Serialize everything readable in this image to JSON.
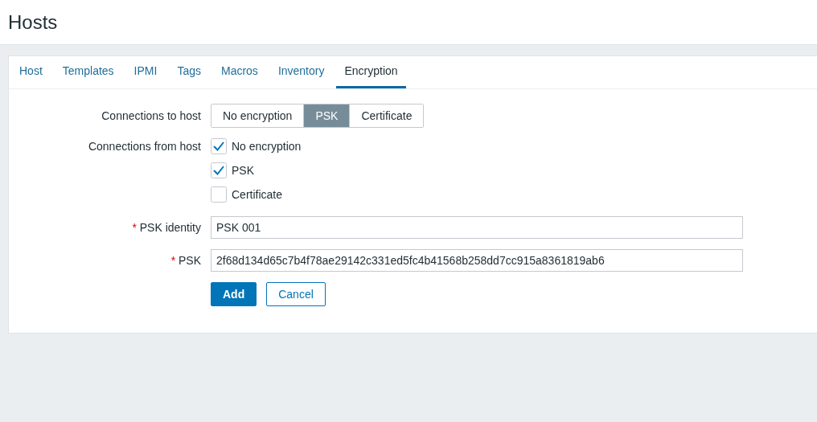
{
  "page_title": "Hosts",
  "tabs": [
    {
      "label": "Host",
      "selected": false
    },
    {
      "label": "Templates",
      "selected": false
    },
    {
      "label": "IPMI",
      "selected": false
    },
    {
      "label": "Tags",
      "selected": false
    },
    {
      "label": "Macros",
      "selected": false
    },
    {
      "label": "Inventory",
      "selected": false
    },
    {
      "label": "Encryption",
      "selected": true
    }
  ],
  "connections_to_host": {
    "label": "Connections to host",
    "options": [
      {
        "label": "No encryption",
        "selected": false
      },
      {
        "label": "PSK",
        "selected": true
      },
      {
        "label": "Certificate",
        "selected": false
      }
    ]
  },
  "connections_from_host": {
    "label": "Connections from host",
    "options": [
      {
        "label": "No encryption",
        "checked": true
      },
      {
        "label": "PSK",
        "checked": true
      },
      {
        "label": "Certificate",
        "checked": false
      }
    ]
  },
  "fields": [
    {
      "required_mark": "*",
      "label": "PSK identity",
      "value": "PSK 001"
    },
    {
      "required_mark": "*",
      "label": "PSK",
      "value": "2f68d134d65c7b4f78ae29142c331ed5fc4b41568b258dd7cc915a8361819ab6"
    }
  ],
  "buttons": [
    {
      "label": "Add",
      "kind": "primary"
    },
    {
      "label": "Cancel",
      "kind": "secondary"
    }
  ]
}
